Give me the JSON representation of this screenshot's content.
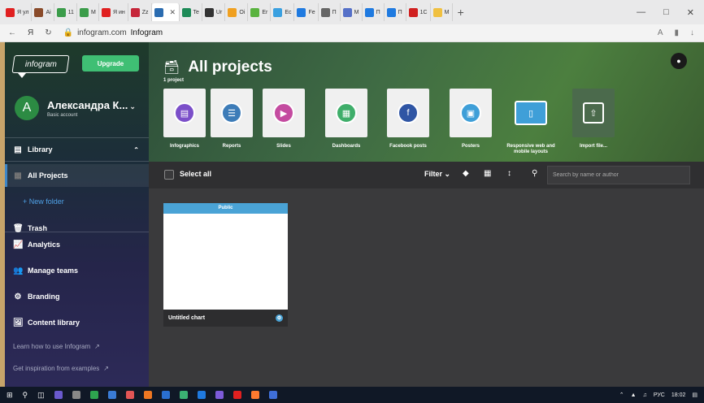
{
  "browser": {
    "tabs": [
      {
        "label": "Я ул",
        "color": "#e02020"
      },
      {
        "label": "Ai",
        "color": "#8a4b2a"
      },
      {
        "label": "11",
        "color": "#3b9c4a"
      },
      {
        "label": "M",
        "color": "#3b9c4a"
      },
      {
        "label": "Я ин",
        "color": "#e02020"
      },
      {
        "label": "Zz",
        "color": "#c6263a"
      },
      {
        "label": "",
        "color": "#2b6cb0",
        "active": true
      },
      {
        "label": "Te",
        "color": "#1d8a57"
      },
      {
        "label": "Ur",
        "color": "#333333"
      },
      {
        "label": "Oi",
        "color": "#f0a020"
      },
      {
        "label": "Er",
        "color": "#5ab33f"
      },
      {
        "label": "Ec",
        "color": "#3aa0e0"
      },
      {
        "label": "Fe",
        "color": "#1f7ae0"
      },
      {
        "label": "П",
        "color": "#666666"
      },
      {
        "label": "M",
        "color": "#5570c8"
      },
      {
        "label": "П",
        "color": "#1f7ae0"
      },
      {
        "label": "П",
        "color": "#1f7ae0"
      },
      {
        "label": "1C",
        "color": "#d02020"
      },
      {
        "label": "M",
        "color": "#f0c040"
      }
    ],
    "address_domain": "infogram.com",
    "address_title": "Infogram",
    "address_right": "A",
    "window_controls": [
      "—",
      "□",
      "✕"
    ]
  },
  "sidebar": {
    "logo": "infogram",
    "upgrade_label": "Upgrade",
    "user_initial": "A",
    "user_name": "Александра К...",
    "user_plan": "Basic account",
    "library_label": "Library",
    "all_projects_label": "All Projects",
    "new_folder_label": "+ New folder",
    "trash_label": "Trash",
    "analytics_label": "Analytics",
    "manage_teams_label": "Manage teams",
    "branding_label": "Branding",
    "content_library_label": "Content library",
    "learn_link": "Learn how to use Infogram",
    "inspiration_link": "Get inspiration from examples"
  },
  "hero": {
    "title": "All projects",
    "count": "1 project",
    "types": [
      {
        "label": "Infographics",
        "color": "#7b4fc9",
        "icon": "infographic-icon"
      },
      {
        "label": "Reports",
        "color": "#3d7cb8",
        "icon": "report-icon"
      },
      {
        "label": "Slides",
        "color": "#c44ba0",
        "icon": "slides-icon"
      },
      {
        "label": "Dashboards",
        "color": "#3fae6a",
        "icon": "dashboard-icon"
      },
      {
        "label": "Facebook posts",
        "color": "#2f55a4",
        "icon": "facebook-icon"
      },
      {
        "label": "Posters",
        "color": "#3f9fd8",
        "icon": "poster-icon"
      },
      {
        "label": "Responsive web and mobile layouts",
        "color": "#3f9fd8",
        "icon": "responsive-icon"
      },
      {
        "label": "Import file...",
        "color": "#555555",
        "icon": "import-icon"
      }
    ]
  },
  "toolbar": {
    "select_all": "Select all",
    "filter_label": "Filter",
    "search_placeholder": "Search by name or author"
  },
  "project": {
    "badge": "Public",
    "name": "Untitled chart"
  },
  "taskbar": {
    "lang": "РУС",
    "time": "18:02"
  }
}
